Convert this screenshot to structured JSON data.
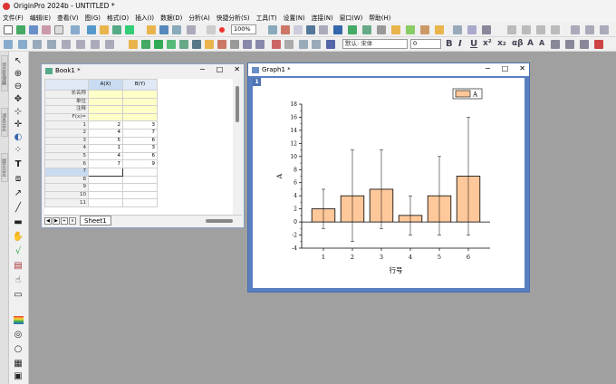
{
  "app": {
    "title": "OriginPro 2024b - UNTITLED *"
  },
  "menu": [
    "文件(F)",
    "编辑(E)",
    "查看(V)",
    "图(G)",
    "格式(O)",
    "插入(I)",
    "数据(D)",
    "分析(A)",
    "快捷分析(S)",
    "工具(T)",
    "设置(N)",
    "连接(N)",
    "窗口(W)",
    "帮助(H)"
  ],
  "toolbar": {
    "zoom": "100%",
    "font": "默认: 宋体",
    "font_size": "0"
  },
  "left_strip": [
    "项目管理器",
    "消息日志",
    "提示日志"
  ],
  "book": {
    "title": "Book1 *",
    "columns": [
      "A(X)",
      "B(Y)"
    ],
    "meta_rows": [
      "长名称",
      "单位",
      "注释",
      "F(x)="
    ],
    "rows": [
      {
        "n": "1",
        "a": "2",
        "b": "3"
      },
      {
        "n": "2",
        "a": "4",
        "b": "7"
      },
      {
        "n": "3",
        "a": "5",
        "b": "6"
      },
      {
        "n": "4",
        "a": "1",
        "b": "3"
      },
      {
        "n": "5",
        "a": "4",
        "b": "6"
      },
      {
        "n": "6",
        "a": "7",
        "b": "9"
      },
      {
        "n": "7",
        "a": "",
        "b": ""
      },
      {
        "n": "8",
        "a": "",
        "b": ""
      },
      {
        "n": "9",
        "a": "",
        "b": ""
      },
      {
        "n": "10",
        "a": "",
        "b": ""
      },
      {
        "n": "11",
        "a": "",
        "b": ""
      }
    ],
    "sheet": "Sheet1"
  },
  "graph": {
    "title": "Graph1 *",
    "layer": "1"
  },
  "chart_data": {
    "type": "bar",
    "categories": [
      "1",
      "2",
      "3",
      "4",
      "5",
      "6"
    ],
    "series": [
      {
        "name": "A",
        "values": [
          2,
          4,
          5,
          1,
          4,
          7
        ],
        "error": [
          3,
          7,
          6,
          3,
          6,
          9
        ],
        "color": "#ffc89a"
      }
    ],
    "xlabel": "行号",
    "ylabel": "A",
    "ylim": [
      -4,
      18
    ],
    "yticks": [
      "-4",
      "-2",
      "0",
      "2",
      "4",
      "6",
      "8",
      "10",
      "12",
      "14",
      "16",
      "18"
    ],
    "legend": "top-right",
    "grid": false
  }
}
